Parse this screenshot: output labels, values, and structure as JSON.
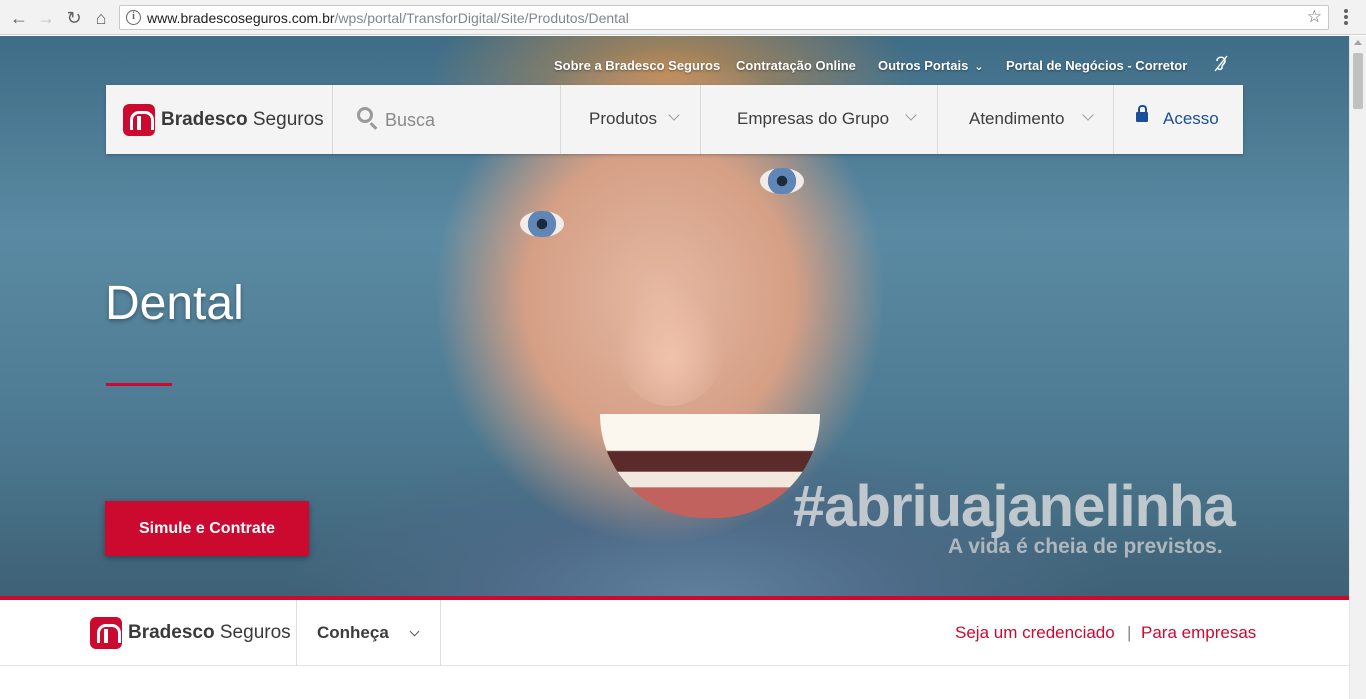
{
  "browser": {
    "url_domain": "www.bradescoseguros.com.br",
    "url_path": "/wps/portal/TransforDigital/Site/Produtos/Dental"
  },
  "topnav": {
    "sobre": "Sobre a Bradesco Seguros",
    "contratacao": "Contratação Online",
    "outros": "Outros Portais",
    "portal": "Portal de Negócios - Corretor"
  },
  "brand": {
    "bold": "Bradesco",
    "light": " Seguros"
  },
  "search": {
    "placeholder": "Busca"
  },
  "menu": {
    "produtos": "Produtos",
    "empresas": "Empresas do Grupo",
    "atendimento": "Atendimento",
    "acesso": "Acesso"
  },
  "hero": {
    "title": "Dental",
    "cta": "Simule e Contrate",
    "hashtag": "#abriuajanelinha",
    "tagline": "A vida é cheia de previstos."
  },
  "subbar": {
    "conheca": "Conheça",
    "credenciado": "Seja um credenciado",
    "separator": "|",
    "empresas": "Para empresas"
  },
  "colors": {
    "brand_red": "#cc092f",
    "link_blue": "#1a4f9c"
  }
}
